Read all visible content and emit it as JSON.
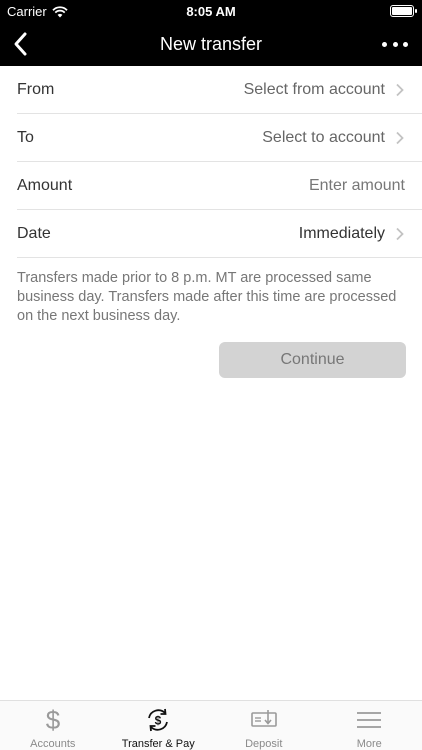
{
  "status_bar": {
    "carrier": "Carrier",
    "time": "8:05 AM"
  },
  "nav": {
    "title": "New transfer"
  },
  "form": {
    "rows": [
      {
        "label": "From",
        "value": "Select from account"
      },
      {
        "label": "To",
        "value": "Select to account"
      },
      {
        "label": "Amount",
        "placeholder": "Enter amount"
      },
      {
        "label": "Date",
        "value": "Immediately"
      }
    ]
  },
  "note": "Transfers made prior to 8 p.m. MT are processed same business day. Transfers made after this time are processed on the next business day.",
  "continue_label": "Continue",
  "tabs": [
    {
      "label": "Accounts",
      "icon": "dollar-icon"
    },
    {
      "label": "Transfer & Pay",
      "icon": "transfer-cycle-icon",
      "active": true
    },
    {
      "label": "Deposit",
      "icon": "check-deposit-icon"
    },
    {
      "label": "More",
      "icon": "menu-icon"
    }
  ]
}
